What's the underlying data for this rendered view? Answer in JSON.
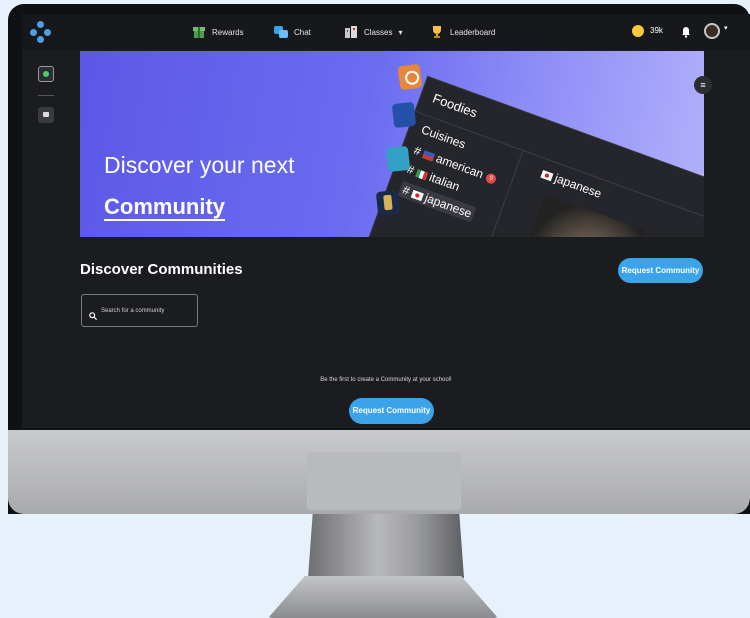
{
  "nav": {
    "rewards": "Rewards",
    "chat": "Chat",
    "classes": "Classes",
    "classes_caret": "▾",
    "leaderboard": "Leaderboard",
    "coins": "39k"
  },
  "hero": {
    "line1": "Discover your next",
    "line2": "Community",
    "panel": {
      "header": "Foodies",
      "section": "Cuisines",
      "items": [
        "american",
        "italian",
        "japanese"
      ],
      "american_badge": "5",
      "selected_channel": "japanese"
    }
  },
  "main": {
    "title": "Discover Communities",
    "request_button": "Request Community",
    "search_placeholder": "Search for a community",
    "empty_message": "Be the first to create a Community at your school!",
    "request_button_bottom": "Request Community"
  },
  "colors": {
    "accent": "#3aa3ea",
    "background": "#1b1c20",
    "hero_start": "#5c58e8",
    "hero_end": "#b3b1fb"
  }
}
